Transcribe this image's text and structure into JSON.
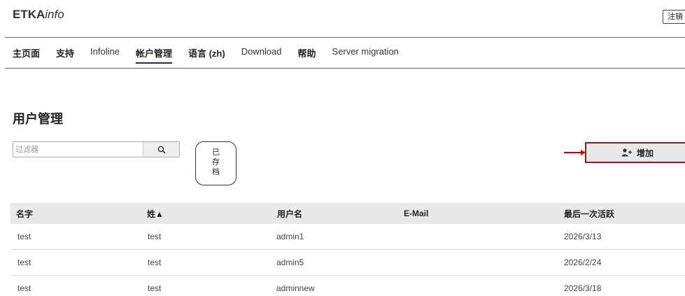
{
  "header": {
    "logo_bold": "ETKA",
    "logo_italic": "info",
    "logout_label": "注销"
  },
  "nav": {
    "items": [
      {
        "label": "主页面",
        "style": "bold",
        "active": false
      },
      {
        "label": "支持",
        "style": "bold",
        "active": false
      },
      {
        "label": "Infoline",
        "style": "normal",
        "active": false
      },
      {
        "label": "帐户管理",
        "style": "bold",
        "active": true
      },
      {
        "label": "语言 (zh)",
        "style": "bold",
        "active": false
      },
      {
        "label": "Download",
        "style": "normal",
        "active": false
      },
      {
        "label": "帮助",
        "style": "bold",
        "active": false
      },
      {
        "label": "Server migration",
        "style": "normal",
        "active": false
      }
    ]
  },
  "main": {
    "title": "用户管理",
    "filter_placeholder": "过滤器",
    "archived_button": [
      "已",
      "存",
      "档"
    ],
    "add_button_label": "增加"
  },
  "table": {
    "columns": [
      "名字",
      "姓▲",
      "用户名",
      "E-Mail",
      "最后一次活跃"
    ],
    "rows": [
      [
        "test",
        "test",
        "admin1",
        "",
        "2026/3/13"
      ],
      [
        "test",
        "test",
        "admin5",
        "",
        "2026/2/24"
      ],
      [
        "test",
        "test",
        "adminnew",
        "",
        "2026/3/18"
      ]
    ]
  },
  "colors": {
    "active_underline": "#1a2a6c",
    "add_button_border": "#8b1a1a",
    "annotation_arrow": "#cc0000",
    "header_bg": "#e9e9e9"
  },
  "icons": {
    "search": "search-icon",
    "add_user": "add-user-icon"
  }
}
